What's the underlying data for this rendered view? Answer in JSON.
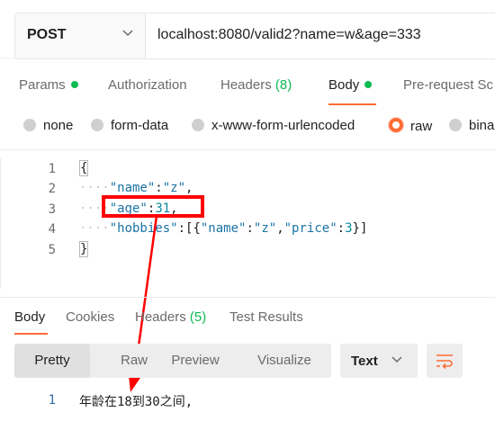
{
  "request": {
    "method": "POST",
    "url": "localhost:8080/valid2?name=w&age=333"
  },
  "request_tabs": [
    {
      "label": "Params",
      "dot": true
    },
    {
      "label": "Authorization"
    },
    {
      "label": "Headers",
      "count": "(8)"
    },
    {
      "label": "Body",
      "dot": true,
      "active": true
    },
    {
      "label": "Pre-request Sc"
    }
  ],
  "body_types": [
    {
      "label": "none"
    },
    {
      "label": "form-data"
    },
    {
      "label": "x-www-form-urlencoded"
    },
    {
      "label": "raw",
      "selected": true
    },
    {
      "label": "bina"
    }
  ],
  "editor": {
    "line_numbers": [
      "1",
      "2",
      "3",
      "4",
      "5"
    ],
    "lines": [
      {
        "brace_open": "{"
      },
      {
        "key": "\"name\"",
        "colon": ":",
        "value": "\"z\"",
        "comma": ","
      },
      {
        "key": "\"age\"",
        "colon": ":",
        "value": "31",
        "comma": ","
      },
      {
        "key": "\"hobbies\"",
        "colon": ":",
        "open": "[{",
        "k1": "\"name\"",
        "v1": "\"z\"",
        "k2": "\"price\"",
        "v2": "3",
        "close": "}]"
      },
      {
        "brace_close": "}"
      }
    ]
  },
  "response_tabs": [
    {
      "label": "Body",
      "active": true
    },
    {
      "label": "Cookies"
    },
    {
      "label": "Headers",
      "count": "(5)"
    },
    {
      "label": "Test Results"
    }
  ],
  "view_modes": [
    "Pretty",
    "Raw",
    "Preview",
    "Visualize"
  ],
  "format": "Text",
  "response": {
    "line_number": "1",
    "text": "年龄在18到30之间,"
  },
  "colors": {
    "accent": "#ff6c37",
    "status_green": "#0cbb52",
    "annotation_red": "#ff0000"
  },
  "icons": {
    "method_chevron": "chevron-down-icon",
    "format_chevron": "chevron-down-icon",
    "wrap": "wrap-lines-icon"
  }
}
